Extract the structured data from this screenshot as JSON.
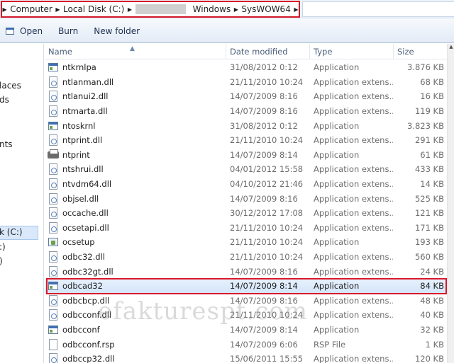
{
  "address_bar": {
    "crumbs": [
      "Computer",
      "Local Disk (C:)",
      "Windows",
      "SysWOW64"
    ]
  },
  "toolbar": {
    "open_label": "Open",
    "burn_label": "Burn",
    "new_folder_label": "New folder"
  },
  "nav_pane": {
    "items": [
      "laces",
      "ds",
      "nts",
      "k (C:)",
      ":)",
      ")"
    ]
  },
  "columns": {
    "name": "Name",
    "date": "Date modified",
    "type": "Type",
    "size": "Size"
  },
  "files": [
    {
      "name": "ntkrnlpa",
      "date": "31/08/2012 0:12",
      "type": "Application",
      "size": "3.876 KB",
      "icon": "application-icon"
    },
    {
      "name": "ntlanman.dll",
      "date": "21/11/2010 10:24",
      "type": "Application extens...",
      "size": "68 KB",
      "icon": "dll-icon"
    },
    {
      "name": "ntlanui2.dll",
      "date": "14/07/2009 8:16",
      "type": "Application extens...",
      "size": "16 KB",
      "icon": "dll-icon"
    },
    {
      "name": "ntmarta.dll",
      "date": "14/07/2009 8:16",
      "type": "Application extens...",
      "size": "119 KB",
      "icon": "dll-icon"
    },
    {
      "name": "ntoskrnl",
      "date": "31/08/2012 0:12",
      "type": "Application",
      "size": "3.823 KB",
      "icon": "application-icon"
    },
    {
      "name": "ntprint.dll",
      "date": "21/11/2010 10:24",
      "type": "Application extens...",
      "size": "291 KB",
      "icon": "dll-icon"
    },
    {
      "name": "ntprint",
      "date": "14/07/2009 8:14",
      "type": "Application",
      "size": "61 KB",
      "icon": "printer-icon"
    },
    {
      "name": "ntshrui.dll",
      "date": "04/01/2012 15:58",
      "type": "Application extens...",
      "size": "433 KB",
      "icon": "dll-icon"
    },
    {
      "name": "ntvdm64.dll",
      "date": "04/10/2012 21:46",
      "type": "Application extens...",
      "size": "14 KB",
      "icon": "dll-icon"
    },
    {
      "name": "objsel.dll",
      "date": "14/07/2009 8:16",
      "type": "Application extens...",
      "size": "525 KB",
      "icon": "dll-icon"
    },
    {
      "name": "occache.dll",
      "date": "30/12/2012 17:08",
      "type": "Application extens...",
      "size": "121 KB",
      "icon": "dll-icon"
    },
    {
      "name": "ocsetapi.dll",
      "date": "21/11/2010 10:24",
      "type": "Application extens...",
      "size": "171 KB",
      "icon": "dll-icon"
    },
    {
      "name": "ocsetup",
      "date": "21/11/2010 10:24",
      "type": "Application",
      "size": "193 KB",
      "icon": "setup-icon"
    },
    {
      "name": "odbc32.dll",
      "date": "21/11/2010 10:24",
      "type": "Application extens...",
      "size": "560 KB",
      "icon": "dll-icon"
    },
    {
      "name": "odbc32gt.dll",
      "date": "14/07/2009 8:16",
      "type": "Application extens...",
      "size": "24 KB",
      "icon": "dll-icon"
    },
    {
      "name": "odbcad32",
      "date": "14/07/2009 8:14",
      "type": "Application",
      "size": "84 KB",
      "icon": "application-icon"
    },
    {
      "name": "odbcbcp.dll",
      "date": "14/07/2009 8:16",
      "type": "Application extens...",
      "size": "48 KB",
      "icon": "dll-icon"
    },
    {
      "name": "odbcconf.dll",
      "date": "21/11/2010 10:24",
      "type": "Application extens...",
      "size": "40 KB",
      "icon": "dll-icon"
    },
    {
      "name": "odbcconf",
      "date": "14/07/2009 8:14",
      "type": "Application",
      "size": "32 KB",
      "icon": "application-icon"
    },
    {
      "name": "odbcconf.rsp",
      "date": "14/07/2009 6:06",
      "type": "RSP File",
      "size": "1 KB",
      "icon": "rsp-file-icon"
    },
    {
      "name": "odbccp32.dll",
      "date": "15/06/2011 15:55",
      "type": "Application extens...",
      "size": "120 KB",
      "icon": "dll-icon"
    }
  ],
  "selected_index": 15,
  "watermark": "efakturespt.com",
  "colors": {
    "highlight_border": "#d8192b",
    "selection": "#d3e5fa",
    "header_text": "#4c607a"
  }
}
